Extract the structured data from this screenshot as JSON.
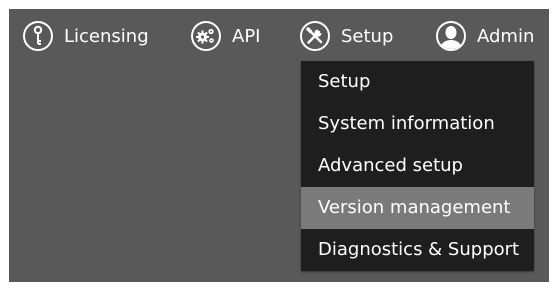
{
  "nav": {
    "licensing": {
      "label": "Licensing",
      "icon": "key-icon"
    },
    "api": {
      "label": "API",
      "icon": "gears-icon"
    },
    "setup": {
      "label": "Setup",
      "icon": "tools-icon"
    },
    "admin": {
      "label": "Admin",
      "icon": "user-icon"
    }
  },
  "setup_menu": {
    "items": [
      {
        "label": "Setup"
      },
      {
        "label": "System information"
      },
      {
        "label": "Advanced setup"
      },
      {
        "label": "Version management",
        "highlighted": true
      },
      {
        "label": "Diagnostics & Support"
      }
    ]
  },
  "colors": {
    "background": "#595959",
    "menu_background": "#1e1e1e",
    "menu_highlight": "#7a7a7a",
    "text": "#ffffff"
  }
}
